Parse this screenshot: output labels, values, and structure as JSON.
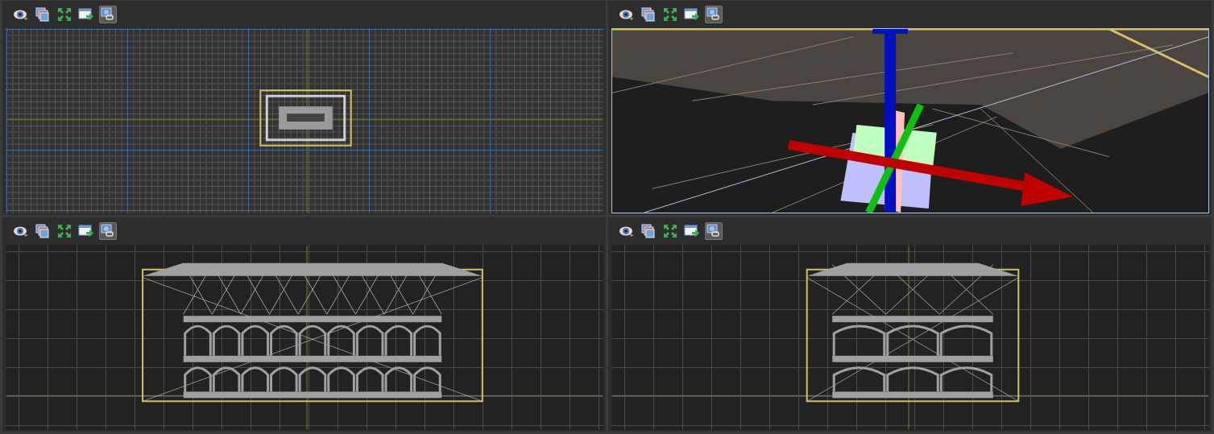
{
  "viewports": [
    {
      "kind": "top",
      "active": false,
      "tools": [
        {
          "kind": "eye",
          "selected": false
        },
        {
          "kind": "layers",
          "selected": false
        },
        {
          "kind": "expand",
          "selected": false
        },
        {
          "kind": "export",
          "selected": false
        },
        {
          "kind": "link",
          "selected": true
        }
      ]
    },
    {
      "kind": "perspective",
      "active": true,
      "tools": [
        {
          "kind": "eye",
          "selected": false
        },
        {
          "kind": "layers",
          "selected": false
        },
        {
          "kind": "expand",
          "selected": false
        },
        {
          "kind": "export",
          "selected": false
        },
        {
          "kind": "link",
          "selected": true
        }
      ]
    },
    {
      "kind": "front",
      "active": false,
      "tools": [
        {
          "kind": "eye",
          "selected": false
        },
        {
          "kind": "layers",
          "selected": false
        },
        {
          "kind": "expand",
          "selected": false
        },
        {
          "kind": "export",
          "selected": false
        },
        {
          "kind": "link",
          "selected": true
        }
      ]
    },
    {
      "kind": "side",
      "active": false,
      "tools": [
        {
          "kind": "eye",
          "selected": false
        },
        {
          "kind": "layers",
          "selected": false
        },
        {
          "kind": "expand",
          "selected": false
        },
        {
          "kind": "export",
          "selected": false
        },
        {
          "kind": "link",
          "selected": true
        }
      ]
    }
  ]
}
